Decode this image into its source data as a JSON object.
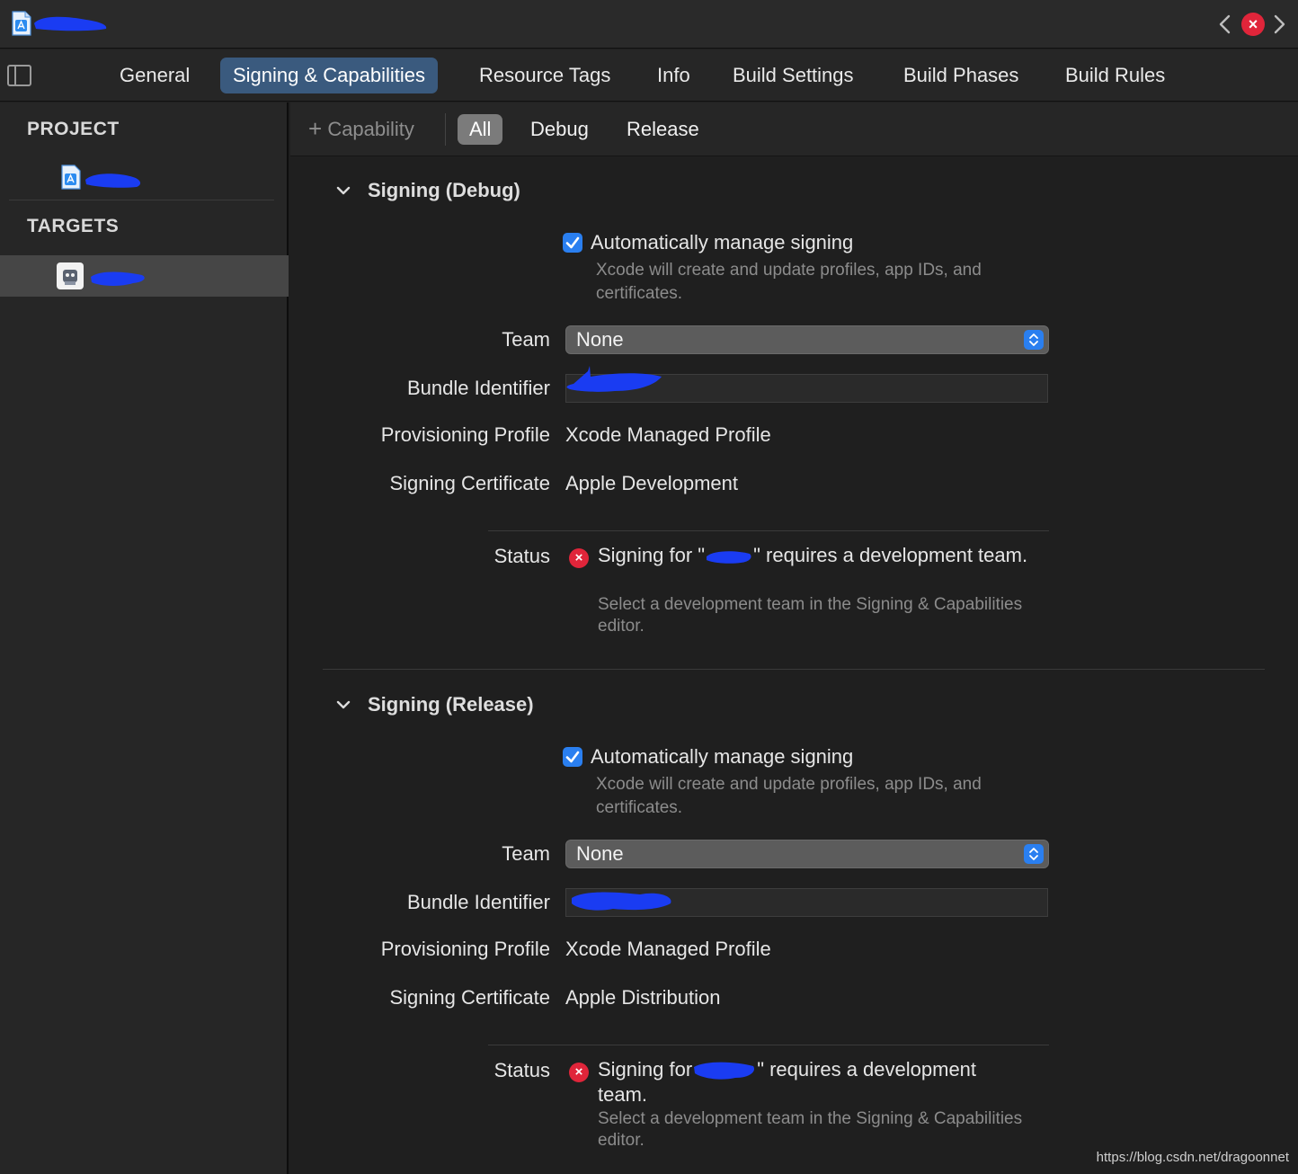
{
  "tabs": {
    "general": "General",
    "signing": "Signing & Capabilities",
    "resource_tags": "Resource Tags",
    "info": "Info",
    "build_settings": "Build Settings",
    "build_phases": "Build Phases",
    "build_rules": "Build Rules"
  },
  "sidebar": {
    "project_header": "PROJECT",
    "targets_header": "TARGETS"
  },
  "filter": {
    "capability": "Capability",
    "all": "All",
    "debug": "Debug",
    "release": "Release"
  },
  "debug": {
    "title": "Signing (Debug)",
    "auto_manage": "Automatically manage signing",
    "auto_hint": "Xcode will create and update profiles, app IDs, and certificates.",
    "team_label": "Team",
    "team_value": "None",
    "bundle_label": "Bundle Identifier",
    "profile_label": "Provisioning Profile",
    "profile_value": "Xcode Managed Profile",
    "cert_label": "Signing Certificate",
    "cert_value": "Apple Development",
    "status_label": "Status",
    "status_pre": "Signing for \"",
    "status_post": "\" requires a development team.",
    "status_sub": "Select a development team in the Signing & Capabilities editor."
  },
  "release": {
    "title": "Signing (Release)",
    "auto_manage": "Automatically manage signing",
    "auto_hint": "Xcode will create and update profiles, app IDs, and certificates.",
    "team_label": "Team",
    "team_value": "None",
    "bundle_label": "Bundle Identifier",
    "profile_label": "Provisioning Profile",
    "profile_value": "Xcode Managed Profile",
    "cert_label": "Signing Certificate",
    "cert_value": "Apple Distribution",
    "status_label": "Status",
    "status_pre": "Signing for",
    "status_post": "\" requires a development team.",
    "status_sub": "Select a development team in the Signing & Capabilities editor."
  },
  "icons": {
    "back": "chevron-left-icon",
    "forward": "chevron-right-icon",
    "error": "error-icon",
    "sidebar_toggle": "sidebar-toggle-icon",
    "disclosure": "chevron-down-icon",
    "checkbox": "checkmark-icon",
    "popup": "up-down-arrows-icon",
    "plus": "plus-icon"
  },
  "colors": {
    "accent": "#2a7ff0",
    "error": "#e0253a",
    "selected_tab": "#3a5a7e",
    "redaction": "#1a3cf2"
  },
  "watermark": "https://blog.csdn.net/dragoonnet"
}
